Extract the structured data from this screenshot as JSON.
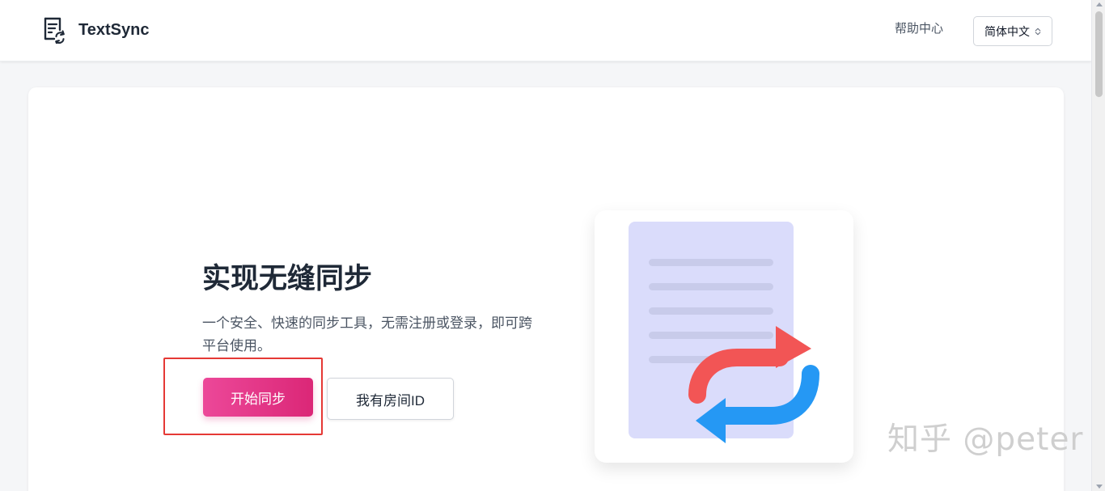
{
  "header": {
    "brand_name": "TextSync",
    "help_label": "帮助中心",
    "language_value": "简体中文"
  },
  "hero": {
    "title": "实现无缝同步",
    "description": "一个安全、快速的同步工具，无需注册或登录，即可跨平台使用。",
    "primary_button_label": "开始同步",
    "secondary_button_label": "我有房间ID"
  },
  "watermark": {
    "text": "知乎 @peter"
  },
  "colors": {
    "primary_gradient_start": "#ec4899",
    "primary_gradient_end": "#db2777",
    "highlight_border": "#e53935",
    "document_background": "#dadcfb",
    "document_lines": "#c8cbea",
    "sync_red": "#f25555",
    "sync_blue": "#2598f4"
  },
  "icons": {
    "brand": "document-sync-icon",
    "language_select": "chevron-up-down-icon",
    "illustration": "document-sync-illustration"
  }
}
